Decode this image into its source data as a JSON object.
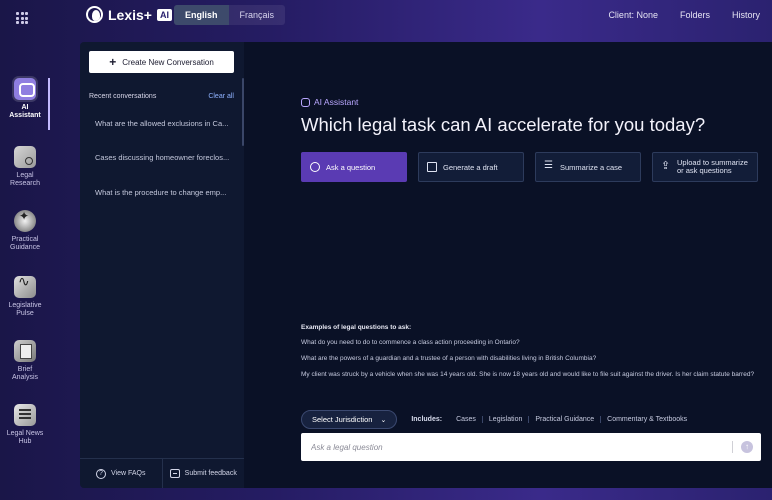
{
  "brand": {
    "name": "Lexis+",
    "badge": "AI"
  },
  "language": {
    "options": [
      "English",
      "Français"
    ],
    "selected": "English"
  },
  "top_nav": {
    "client": "Client: None",
    "folders": "Folders",
    "history": "History"
  },
  "rail": [
    {
      "label1": "AI",
      "label2": "Assistant",
      "icon": "ai-assistant-icon",
      "active": true
    },
    {
      "label1": "Legal",
      "label2": "Research",
      "icon": "legal-research-icon"
    },
    {
      "label1": "Practical",
      "label2": "Guidance",
      "icon": "practical-guidance-icon"
    },
    {
      "label1": "Legislative",
      "label2": "Pulse",
      "icon": "legislative-pulse-icon"
    },
    {
      "label1": "Brief",
      "label2": "Analysis",
      "icon": "brief-analysis-icon"
    },
    {
      "label1": "Legal News",
      "label2": "Hub",
      "icon": "legal-news-hub-icon"
    }
  ],
  "sidebar": {
    "create_label": "Create New Conversation",
    "recent_label": "Recent conversations",
    "clear_label": "Clear all",
    "conversations": [
      "What are the allowed exclusions in Ca...",
      "Cases discussing homeowner foreclos...",
      "What is the procedure to change emp..."
    ],
    "faq_label": "View FAQs",
    "feedback_label": "Submit feedback"
  },
  "main": {
    "tag": "AI Assistant",
    "headline": "Which legal task can AI accelerate for you today?",
    "actions": [
      {
        "label": "Ask a question",
        "icon": "chat-icon",
        "primary": true
      },
      {
        "label": "Generate a draft",
        "icon": "document-icon"
      },
      {
        "label": "Summarize a case",
        "icon": "list-icon"
      },
      {
        "label1": "Upload to summarize",
        "label2": "or ask questions",
        "icon": "upload-icon"
      }
    ],
    "examples_title": "Examples of legal questions to ask:",
    "examples": [
      "What do you need to do to commence a class action proceeding in Ontario?",
      "What are the powers of a guardian and a trustee of a person with disabilities living in British Columbia?",
      "My client was struck by a vehicle when she was 14 years old. She is now 18 years old and would like to file suit against the driver. Is her claim statute barred?"
    ],
    "jurisdiction_label": "Select Jurisdiction",
    "includes_label": "Includes:",
    "includes": [
      "Cases",
      "Legislation",
      "Practical Guidance",
      "Commentary & Textbooks"
    ],
    "ask_placeholder": "Ask a legal question"
  }
}
